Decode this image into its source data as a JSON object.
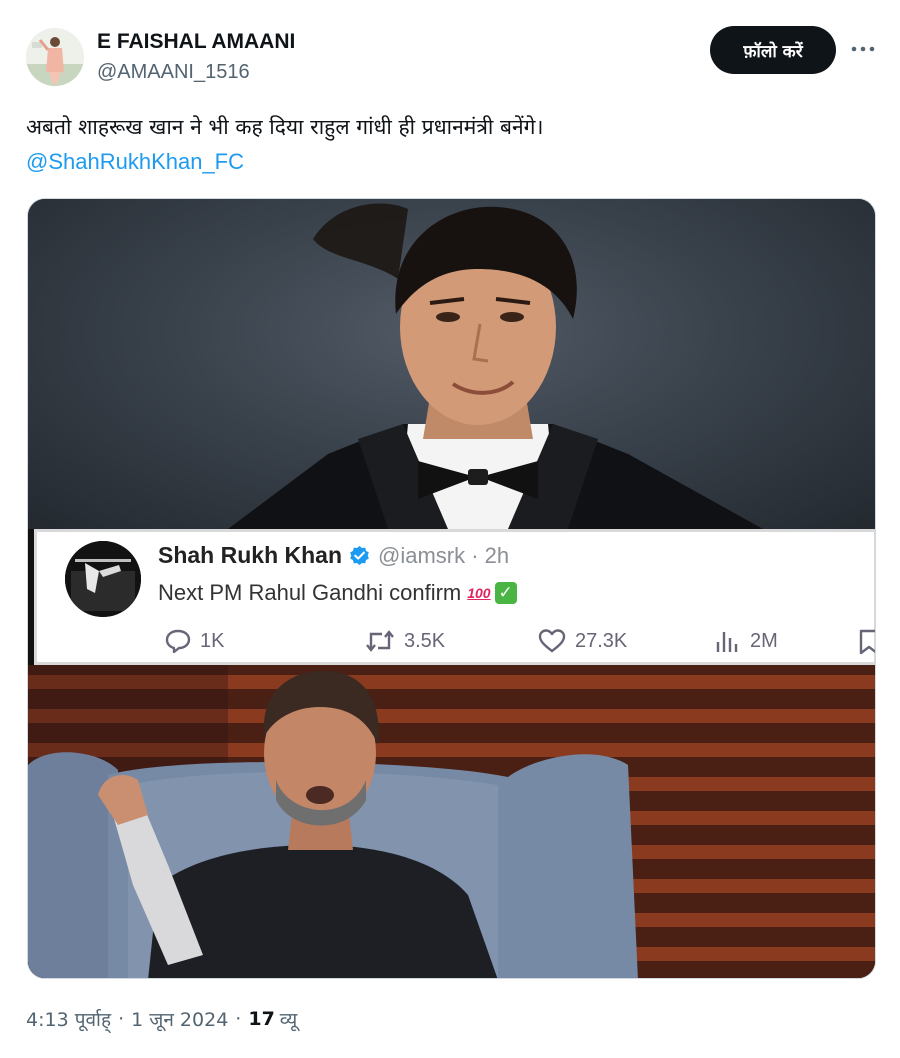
{
  "author": {
    "name": "E FAISHAL AMAANI",
    "handle": "@AMAANI_1516"
  },
  "actions": {
    "follow_label": "फ़ॉलो करें"
  },
  "post": {
    "text": "अबतो शाहरूख खान ने भी कह दिया राहुल गांधी ही प्रधानमंत्री बनेंगे।",
    "mention": "@ShahRukhKhan_FC"
  },
  "embedded_post": {
    "name": "Shah Rukh Khan",
    "handle_time": "@iamsrk · 2h",
    "text": "Next PM Rahul Gandhi confirm",
    "emoji_100": "100",
    "emoji_check": "✓",
    "replies": "1K",
    "reposts": "3.5K",
    "likes": "27.3K",
    "views": "2M"
  },
  "footer": {
    "time": "4:13 पूर्वाह्",
    "date": "1 जून 2024",
    "separator": "·",
    "views_count": "17",
    "views_label": "व्यू"
  },
  "colors": {
    "accent": "#1d9bf0",
    "text_primary": "#0f1419",
    "text_secondary": "#536471",
    "verified": "#1d9bf0"
  },
  "icons": [
    "more-icon",
    "verified-badge-icon",
    "reply-icon",
    "repost-icon",
    "like-icon",
    "views-icon",
    "bookmark-icon"
  ]
}
